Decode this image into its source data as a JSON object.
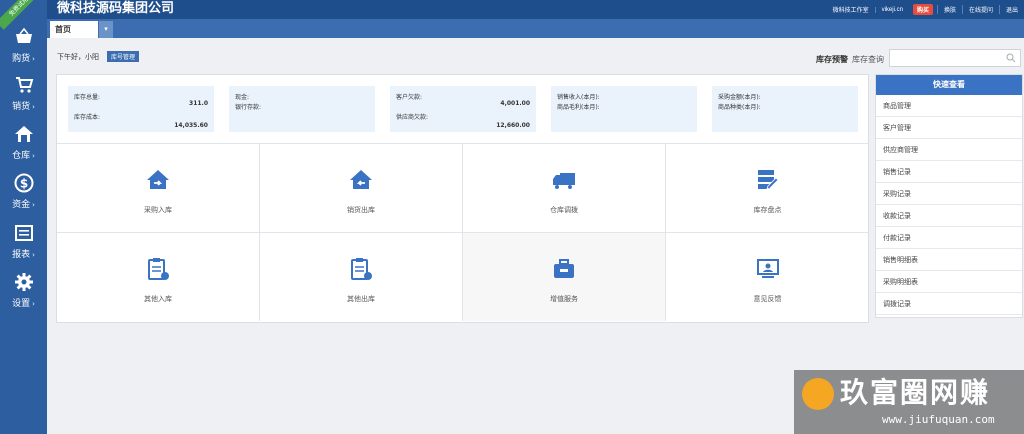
{
  "app": {
    "brand": "微科技源码集团公司",
    "ribbon": "免费试用"
  },
  "toplinks": [
    "微科技工作室",
    "vikeji.cn",
    "购买",
    "换肤",
    "在线提问",
    "退出"
  ],
  "sidebar": {
    "items": [
      {
        "label": "购货",
        "icon": "basket-icon"
      },
      {
        "label": "销货",
        "icon": "cart-icon"
      },
      {
        "label": "仓库",
        "icon": "house-icon"
      },
      {
        "label": "资金",
        "icon": "dollar-icon"
      },
      {
        "label": "报表",
        "icon": "report-icon"
      },
      {
        "label": "设置",
        "icon": "gear-icon"
      }
    ]
  },
  "tabs": {
    "home": "首页",
    "dropdown": "▾"
  },
  "greeting": {
    "text": "下午好，小阳",
    "tag": "库号管理"
  },
  "search": {
    "warn": "库存预警",
    "query": "库存查询",
    "placeholder": ""
  },
  "stats": [
    {
      "l1": "库存总量:",
      "v1": "311.0",
      "l3": "库存成本:",
      "v2": "14,035.60"
    },
    {
      "l1": "现金:",
      "l2": "银行存款:",
      "v1": "",
      "v2": ""
    },
    {
      "l1": "客户欠款:",
      "v1": "4,001.00",
      "l3": "供应商欠款:",
      "v2": "12,660.00"
    },
    {
      "l1": "销售收入(本月):",
      "l2": "商品毛利(本月):",
      "v1": "",
      "v2": ""
    },
    {
      "l1": "采购金额(本月):",
      "l2": "商品种类(本月):",
      "v1": "",
      "v2": ""
    }
  ],
  "actions": [
    {
      "label": "采购入库",
      "icon": "house-in-icon"
    },
    {
      "label": "销货出库",
      "icon": "house-out-icon"
    },
    {
      "label": "仓库调拨",
      "icon": "truck-icon"
    },
    {
      "label": "库存盘点",
      "icon": "inventory-edit-icon"
    },
    {
      "label": "其他入库",
      "icon": "clipboard-in-icon"
    },
    {
      "label": "其他出库",
      "icon": "clipboard-out-icon"
    },
    {
      "label": "增值服务",
      "icon": "toolbox-icon"
    },
    {
      "label": "意见反馈",
      "icon": "feedback-screen-icon"
    }
  ],
  "quick": {
    "title": "快速查看",
    "items": [
      "商品管理",
      "客户管理",
      "供应商管理",
      "销售记录",
      "采购记录",
      "收款记录",
      "付款记录",
      "销售明细表",
      "采购明细表",
      "调拨记录"
    ]
  },
  "watermark": {
    "text": "玖富圈网赚",
    "url": "www.jiufuquan.com"
  },
  "colors": {
    "sidebar": "#2d5e9f",
    "header": "#1f4e8c",
    "accent": "#3b73c4",
    "icon": "#3b73c4"
  }
}
